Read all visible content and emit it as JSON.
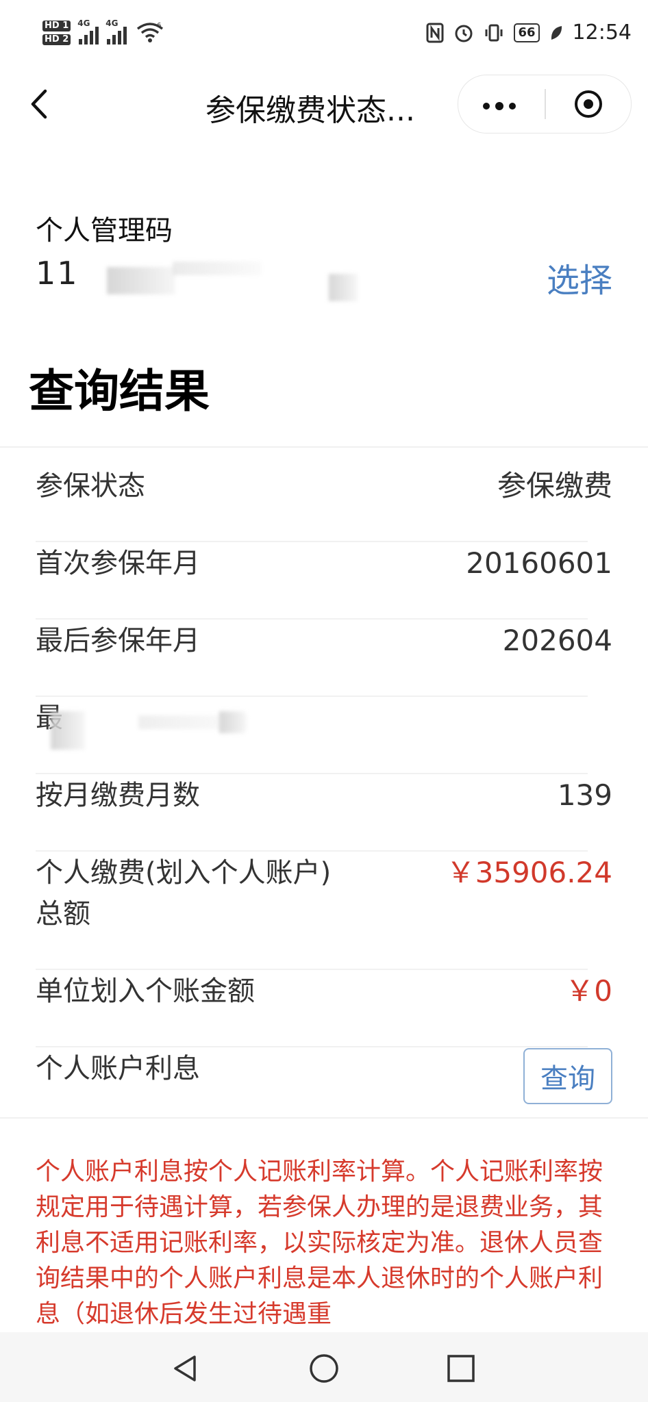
{
  "status": {
    "sim1": "HD 1",
    "sim2": "HD 2",
    "net1": "4G",
    "net2": "4G",
    "wifi_badge": "6",
    "battery": "66",
    "time": "12:54"
  },
  "nav": {
    "title": "参保缴费状态..."
  },
  "code": {
    "label": "个人管理码",
    "value_visible": "11",
    "select": "选择"
  },
  "results": {
    "title": "查询结果",
    "rows": [
      {
        "label": "参保状态",
        "value": "参保缴费"
      },
      {
        "label": "首次参保年月",
        "value": "20160601"
      },
      {
        "label": "最后参保年月",
        "value": "202604"
      },
      {
        "label": "最",
        "value": ""
      },
      {
        "label": "按月缴费月数",
        "value": "139"
      },
      {
        "label": "个人缴费(划入个人账户)总额",
        "value": "￥35906.24"
      },
      {
        "label": "单位划入个账金额",
        "value": "￥0"
      },
      {
        "label": "个人账户利息",
        "value": "查询"
      }
    ]
  },
  "notice": "个人账户利息按个人记账利率计算。个人记账利率按规定用于待遇计算，若参保人办理的是退费业务，其利息不适用记账利率，以实际核定为准。退休人员查询结果中的个人账户利息是本人退休时的个人账户利息（如退休后发生过待遇重",
  "colors": {
    "accent_blue": "#4a7fc1",
    "money_red": "#d1392b",
    "notice_red": "#d63a2c"
  },
  "icons": {
    "back": "back-arrow-icon",
    "more": "more-dots-icon",
    "close": "target-close-icon",
    "nav_back": "triangle-back-icon",
    "nav_home": "circle-home-icon",
    "nav_recent": "square-recent-icon"
  }
}
